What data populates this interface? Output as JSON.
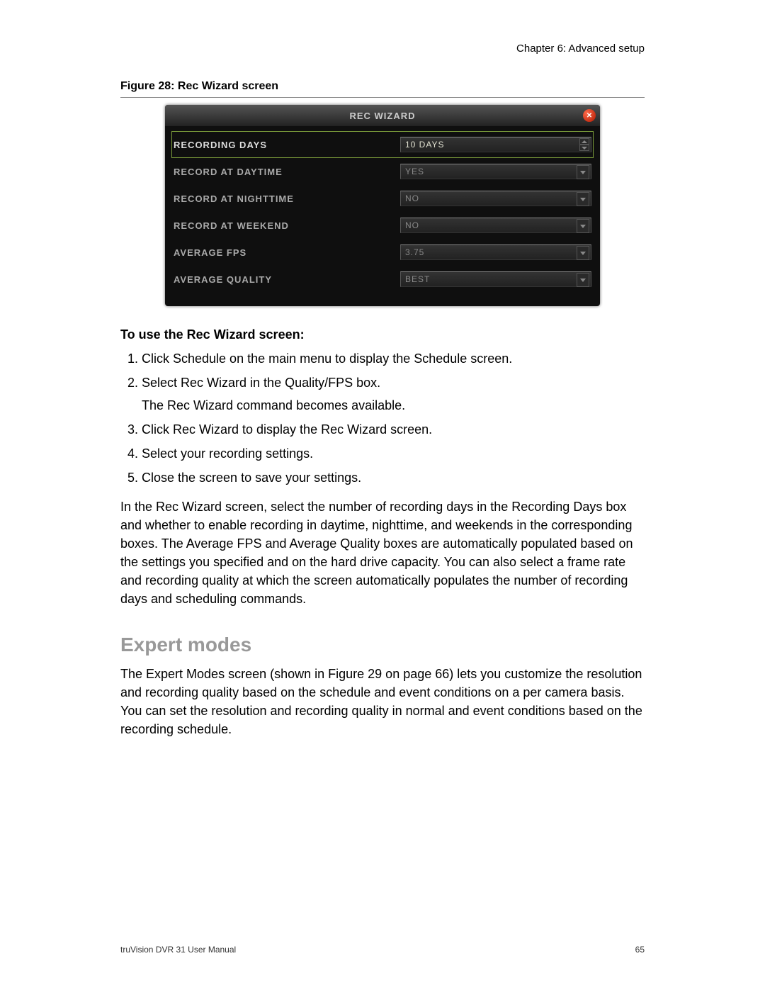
{
  "header": {
    "chapter": "Chapter 6: Advanced setup"
  },
  "figure": {
    "caption": "Figure 28: Rec Wizard screen"
  },
  "screenshot": {
    "title": "REC WIZARD",
    "rows": [
      {
        "label": "RECORDING DAYS",
        "value": "10 DAYS",
        "active": true,
        "control": "spin"
      },
      {
        "label": "RECORD AT DAYTIME",
        "value": "YES",
        "active": false,
        "control": "dd"
      },
      {
        "label": "RECORD AT NIGHTTIME",
        "value": "NO",
        "active": false,
        "control": "dd"
      },
      {
        "label": "RECORD AT WEEKEND",
        "value": "NO",
        "active": false,
        "control": "dd"
      },
      {
        "label": "AVERAGE FPS",
        "value": "3.75",
        "active": false,
        "control": "dd"
      },
      {
        "label": "AVERAGE QUALITY",
        "value": "BEST",
        "active": false,
        "control": "dd"
      }
    ]
  },
  "instructions": {
    "heading": "To use the Rec Wizard screen:",
    "steps": [
      {
        "text": "Click Schedule on the main menu to display the Schedule screen."
      },
      {
        "text": "Select Rec Wizard in the Quality/FPS box.",
        "sub": "The Rec Wizard command becomes available."
      },
      {
        "text": "Click Rec Wizard to display the Rec Wizard screen."
      },
      {
        "text": "Select your recording settings."
      },
      {
        "text": "Close the screen to save your settings."
      }
    ],
    "paragraph": "In the Rec Wizard screen, select the number of recording days in the Recording Days box and whether to enable recording in daytime, nighttime, and weekends in the corresponding boxes. The Average FPS and Average Quality boxes are automatically populated based on the settings you specified and on the hard drive capacity. You can also select a frame rate and recording quality at which the screen automatically populates the number of recording days and scheduling commands."
  },
  "section": {
    "title": "Expert modes",
    "paragraph": "The Expert Modes screen (shown in Figure 29 on page 66) lets you customize the resolution and recording quality based on the schedule and event conditions on a per camera basis. You can set the resolution and recording quality in normal and event conditions based on the recording schedule."
  },
  "footer": {
    "left": "truVision DVR 31 User Manual",
    "right": "65"
  }
}
